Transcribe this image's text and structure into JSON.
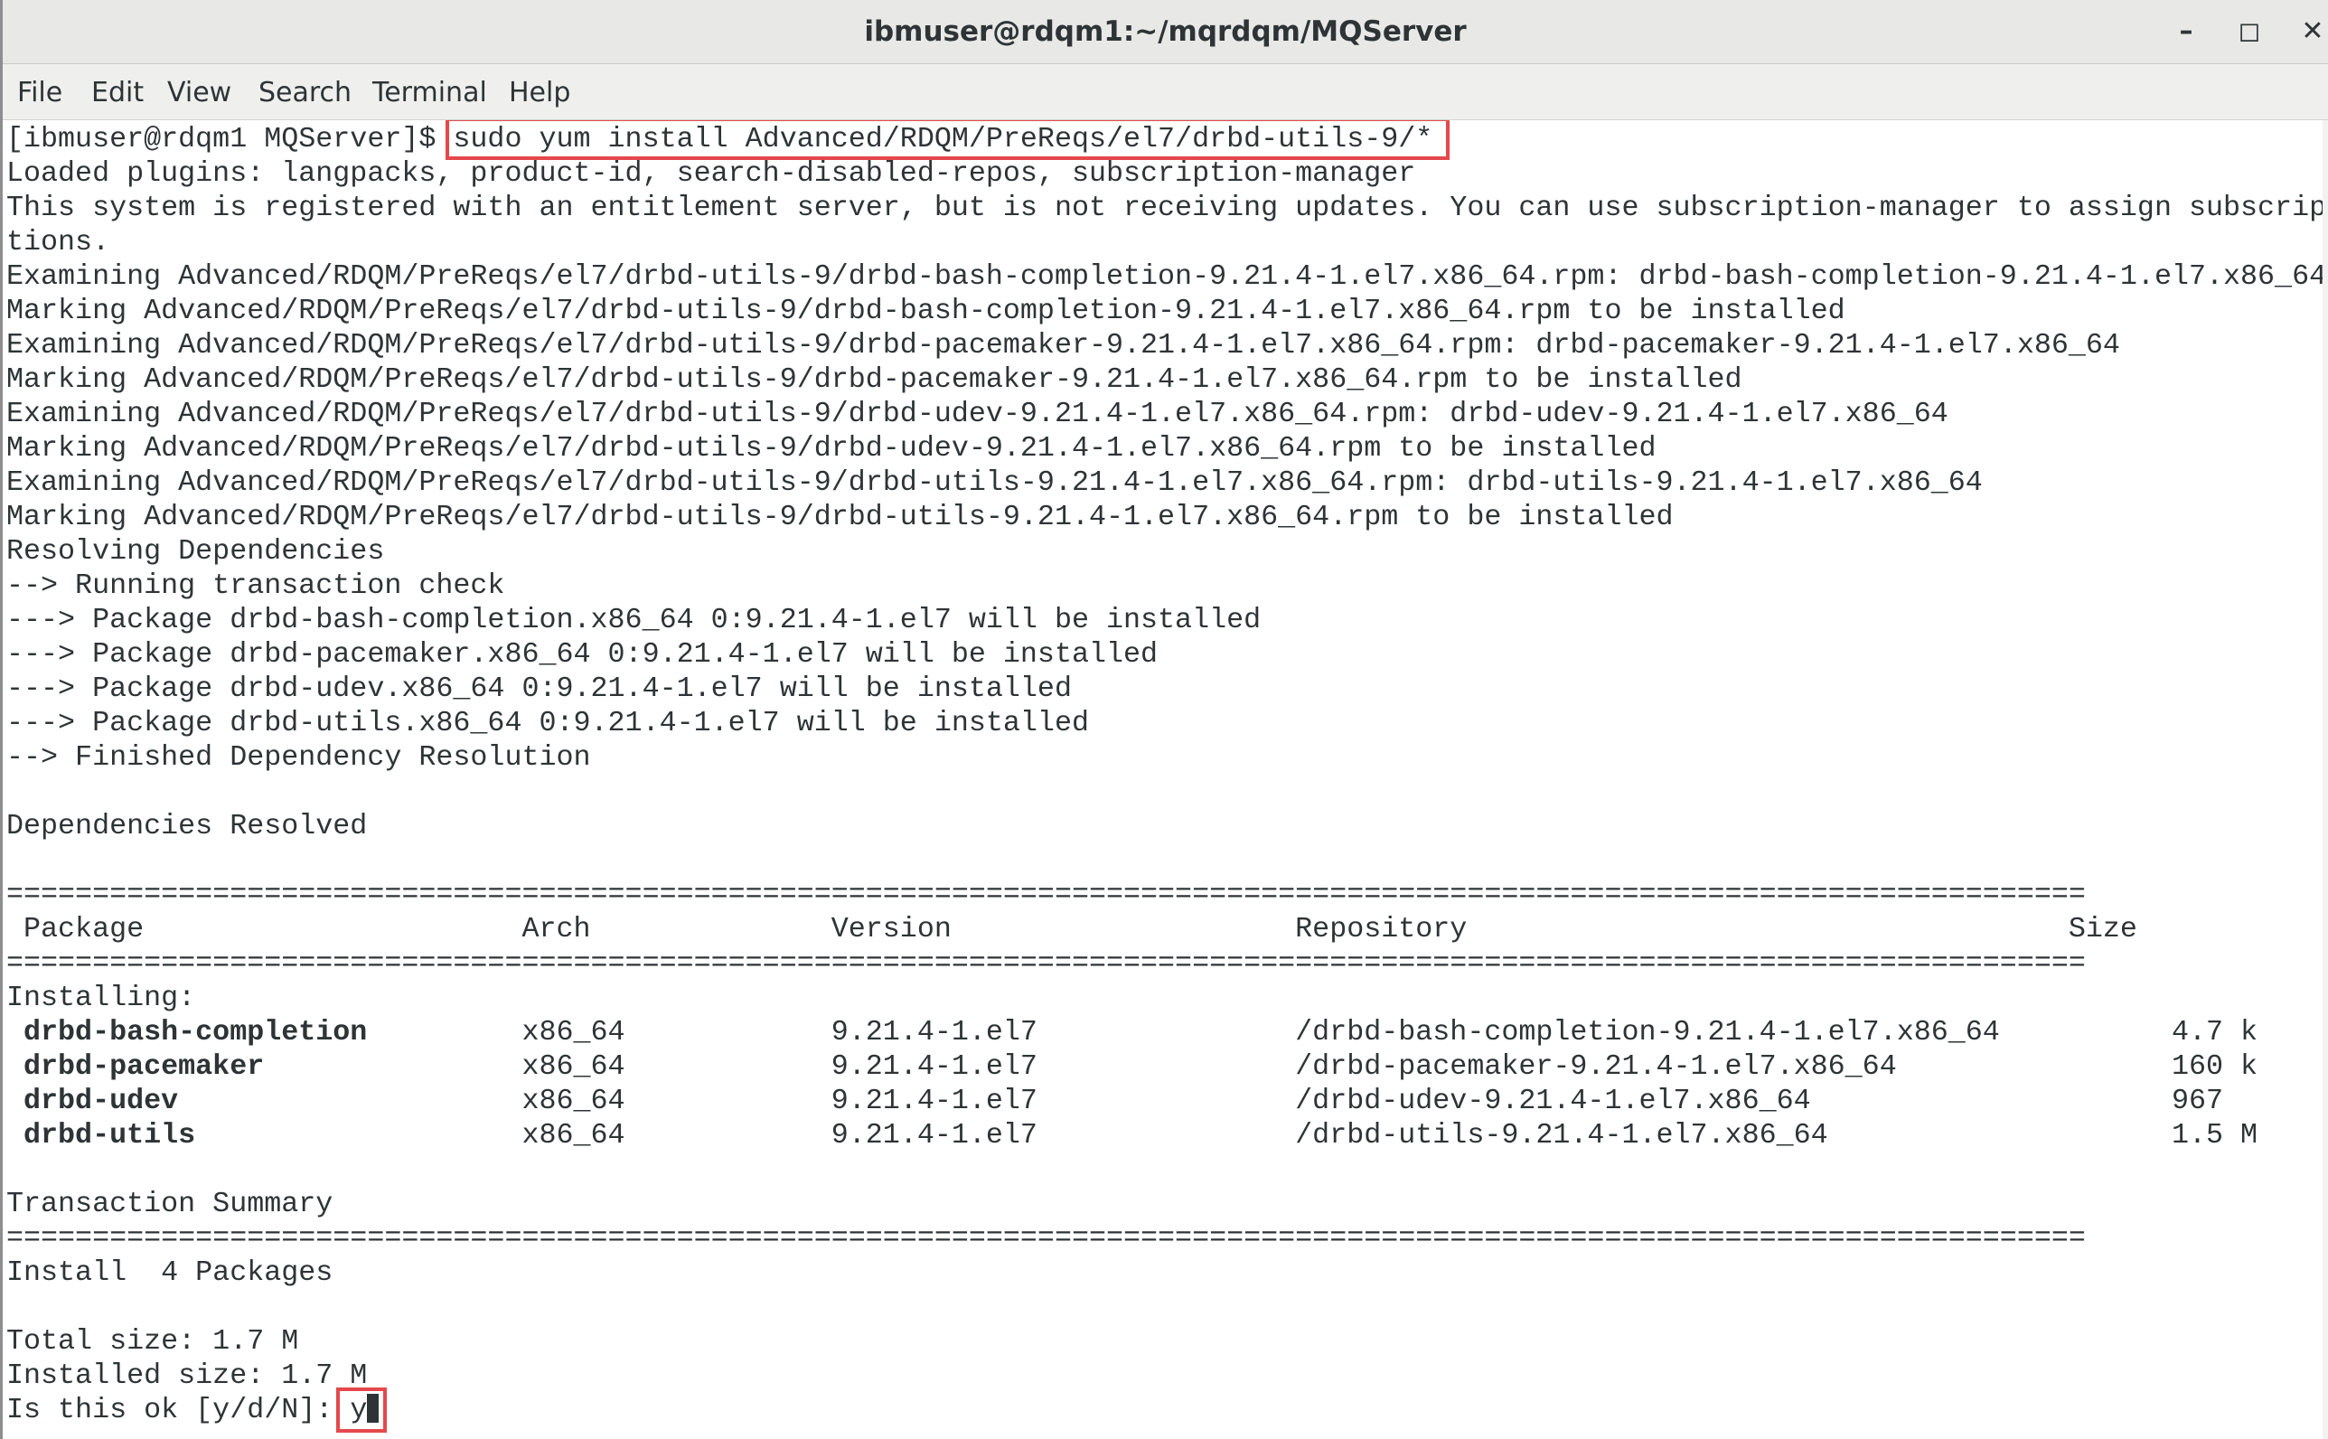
{
  "window": {
    "title": "ibmuser@rdqm1:~/mqrdqm/MQServer",
    "controls": {
      "minimize": "–",
      "maximize": "◻",
      "close": "✕"
    }
  },
  "menu": {
    "file": "File",
    "edit": "Edit",
    "view": "View",
    "search": "Search",
    "terminal": "Terminal",
    "help": "Help"
  },
  "terminal": {
    "prompt": "[ibmuser@rdqm1 MQServer]$ ",
    "command": "sudo yum install Advanced/RDQM/PreReqs/el7/drbd-utils-9/*",
    "lines": [
      "Loaded plugins: langpacks, product-id, search-disabled-repos, subscription-manager",
      "This system is registered with an entitlement server, but is not receiving updates. You can use subscription-manager to assign subscrip",
      "tions.",
      "Examining Advanced/RDQM/PreReqs/el7/drbd-utils-9/drbd-bash-completion-9.21.4-1.el7.x86_64.rpm: drbd-bash-completion-9.21.4-1.el7.x86_64",
      "Marking Advanced/RDQM/PreReqs/el7/drbd-utils-9/drbd-bash-completion-9.21.4-1.el7.x86_64.rpm to be installed",
      "Examining Advanced/RDQM/PreReqs/el7/drbd-utils-9/drbd-pacemaker-9.21.4-1.el7.x86_64.rpm: drbd-pacemaker-9.21.4-1.el7.x86_64",
      "Marking Advanced/RDQM/PreReqs/el7/drbd-utils-9/drbd-pacemaker-9.21.4-1.el7.x86_64.rpm to be installed",
      "Examining Advanced/RDQM/PreReqs/el7/drbd-utils-9/drbd-udev-9.21.4-1.el7.x86_64.rpm: drbd-udev-9.21.4-1.el7.x86_64",
      "Marking Advanced/RDQM/PreReqs/el7/drbd-utils-9/drbd-udev-9.21.4-1.el7.x86_64.rpm to be installed",
      "Examining Advanced/RDQM/PreReqs/el7/drbd-utils-9/drbd-utils-9.21.4-1.el7.x86_64.rpm: drbd-utils-9.21.4-1.el7.x86_64",
      "Marking Advanced/RDQM/PreReqs/el7/drbd-utils-9/drbd-utils-9.21.4-1.el7.x86_64.rpm to be installed",
      "Resolving Dependencies",
      "--> Running transaction check",
      "---> Package drbd-bash-completion.x86_64 0:9.21.4-1.el7 will be installed",
      "---> Package drbd-pacemaker.x86_64 0:9.21.4-1.el7 will be installed",
      "---> Package drbd-udev.x86_64 0:9.21.4-1.el7 will be installed",
      "---> Package drbd-utils.x86_64 0:9.21.4-1.el7 will be installed",
      "--> Finished Dependency Resolution",
      "",
      "Dependencies Resolved",
      "",
      "=========================================================================================================================",
      " Package                      Arch              Version                    Repository                                   Size",
      "=========================================================================================================================",
      "Installing:"
    ],
    "packages": [
      {
        "name": "drbd-bash-completion",
        "rest": "         x86_64            9.21.4-1.el7               /drbd-bash-completion-9.21.4-1.el7.x86_64          4.7 k"
      },
      {
        "name": "drbd-pacemaker",
        "rest": "               x86_64            9.21.4-1.el7               /drbd-pacemaker-9.21.4-1.el7.x86_64                160 k"
      },
      {
        "name": "drbd-udev",
        "rest": "                    x86_64            9.21.4-1.el7               /drbd-udev-9.21.4-1.el7.x86_64                     967"
      },
      {
        "name": "drbd-utils",
        "rest": "                   x86_64            9.21.4-1.el7               /drbd-utils-9.21.4-1.el7.x86_64                    1.5 M"
      }
    ],
    "summary_lines": [
      "",
      "Transaction Summary",
      "=========================================================================================================================",
      "Install  4 Packages",
      "",
      "Total size: 1.7 M",
      "Installed size: 1.7 M"
    ],
    "confirm_prompt": "Is this ok [y/d/N]: ",
    "confirm_input": "y",
    "highlight_color": "#e5484b"
  }
}
